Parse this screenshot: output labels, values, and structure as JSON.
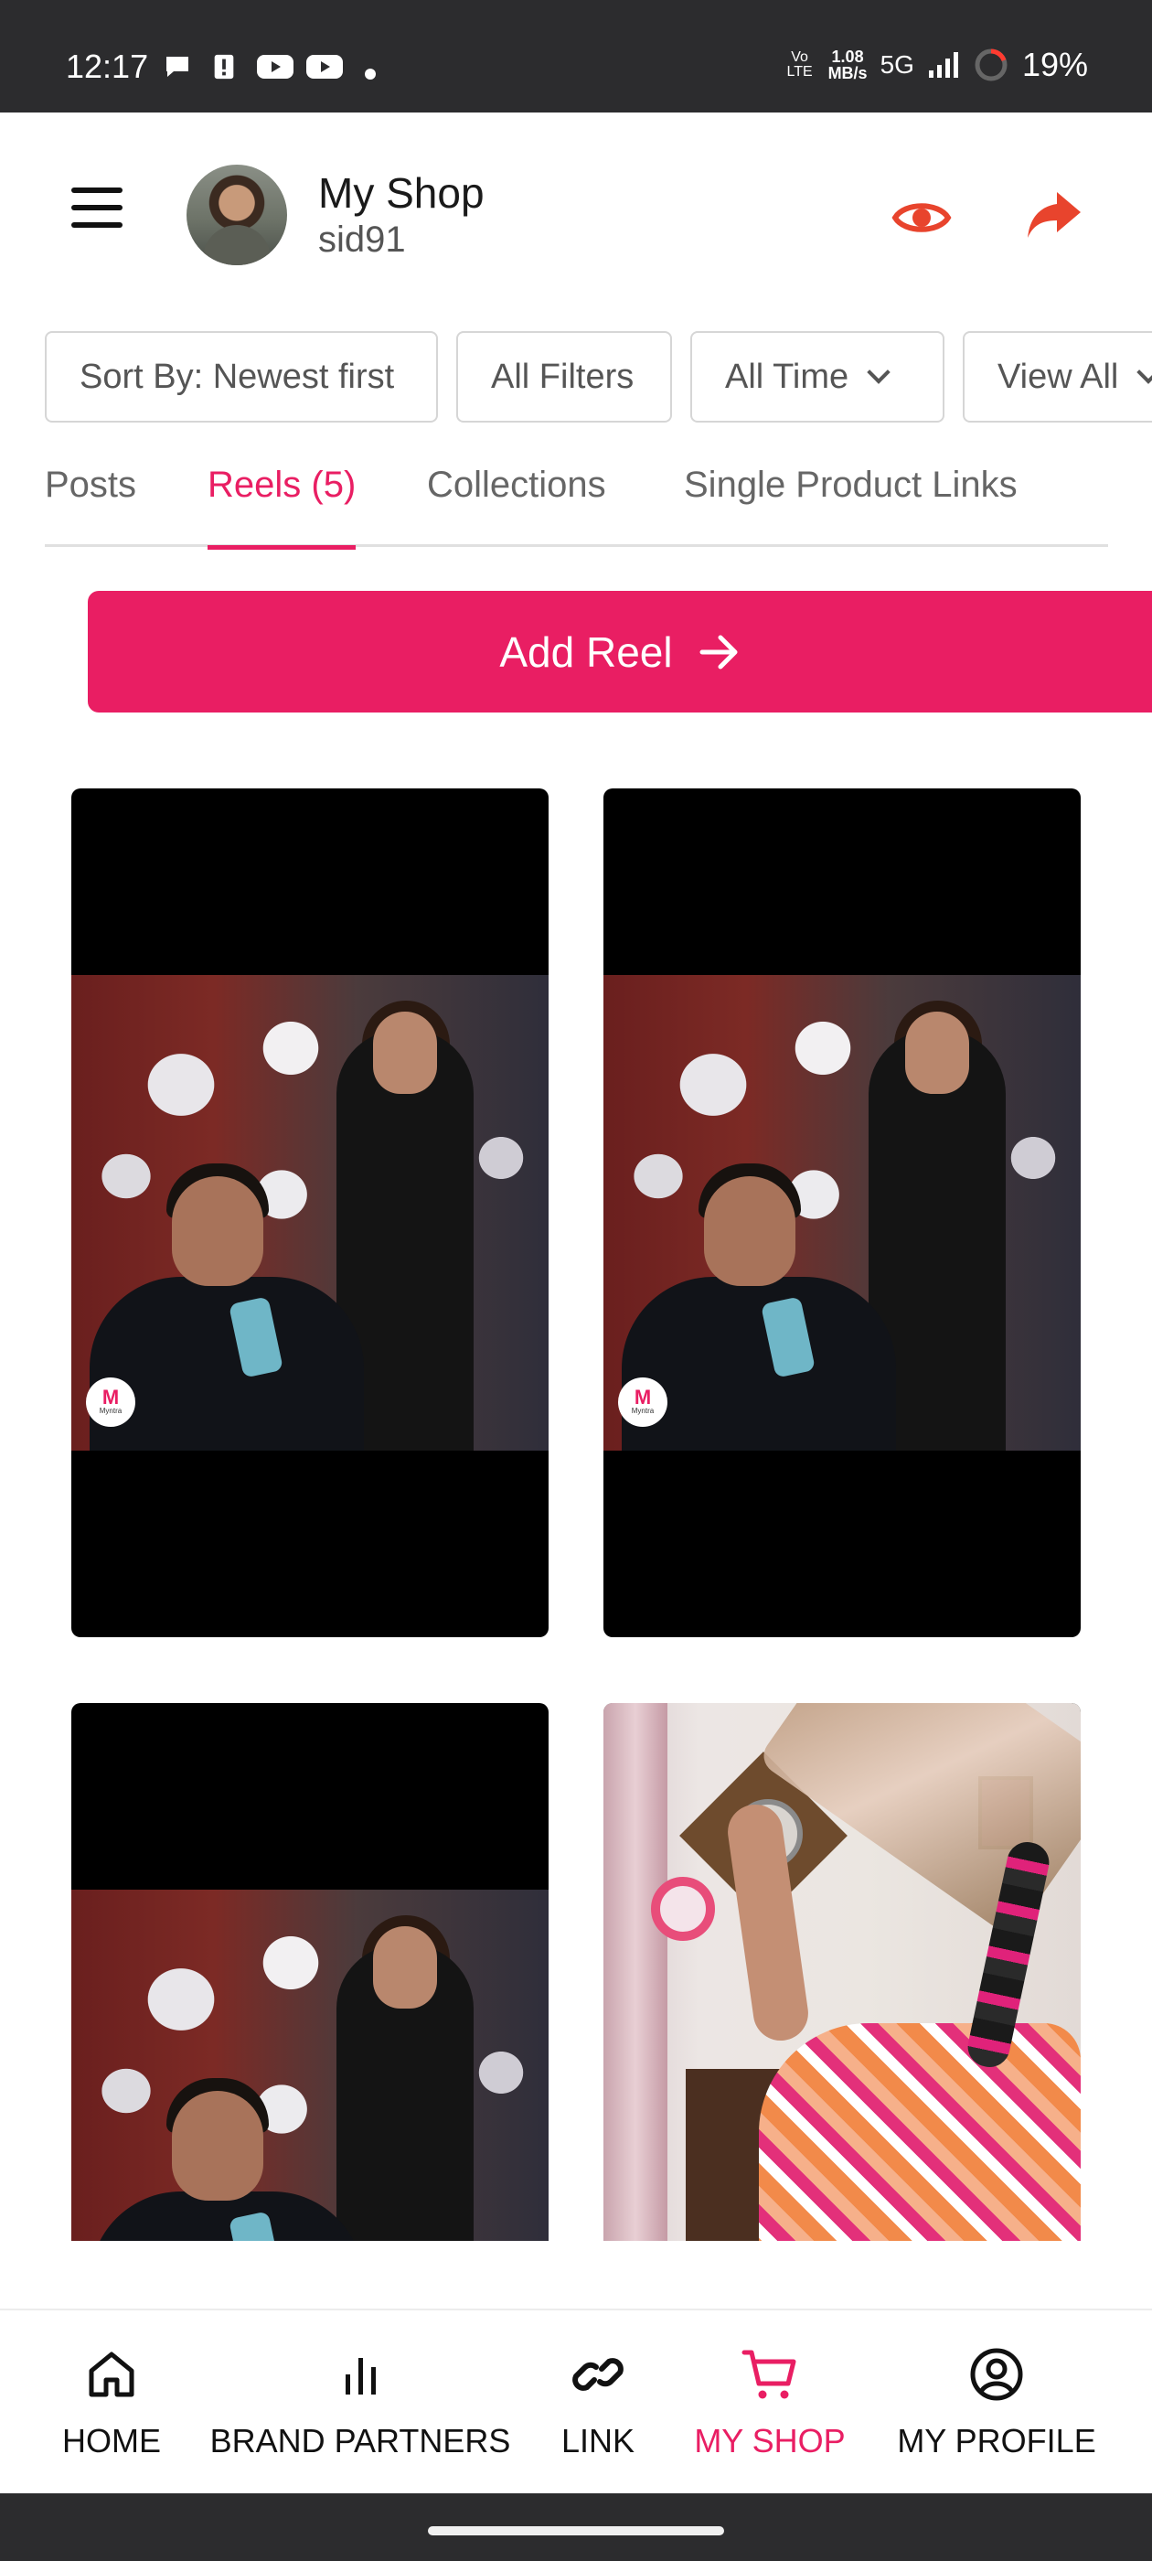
{
  "status_bar": {
    "time": "12:17",
    "network_rate_top": "1.08",
    "network_rate_bottom": "MB/s",
    "network_type": "5G",
    "volte": "Vo LTE",
    "battery": "19%"
  },
  "header": {
    "title": "My Shop",
    "handle": "sid91"
  },
  "filters": {
    "sort": "Sort By: Newest first",
    "all_filters": "All Filters",
    "time": "All Time",
    "view": "View All"
  },
  "tabs": [
    {
      "label": "Posts",
      "active": false
    },
    {
      "label": "Reels (5)",
      "active": true
    },
    {
      "label": "Collections",
      "active": false
    },
    {
      "label": "Single Product Links",
      "active": false
    }
  ],
  "add_reel": {
    "label": "Add Reel"
  },
  "reels": [
    {
      "brand_badge": "Myntra"
    },
    {
      "brand_badge": "Myntra"
    }
  ],
  "bottom_nav": [
    {
      "label": "HOME",
      "icon": "home-icon",
      "active": false
    },
    {
      "label": "BRAND PARTNERS",
      "icon": "bar-chart-icon",
      "active": false
    },
    {
      "label": "LINK",
      "icon": "link-icon",
      "active": false
    },
    {
      "label": "MY SHOP",
      "icon": "cart-icon",
      "active": true
    },
    {
      "label": "MY PROFILE",
      "icon": "user-circle-icon",
      "active": false
    }
  ],
  "colors": {
    "accent": "#e91e63",
    "header_icons": "#e8442d",
    "status_bar": "#2c2c2e"
  }
}
